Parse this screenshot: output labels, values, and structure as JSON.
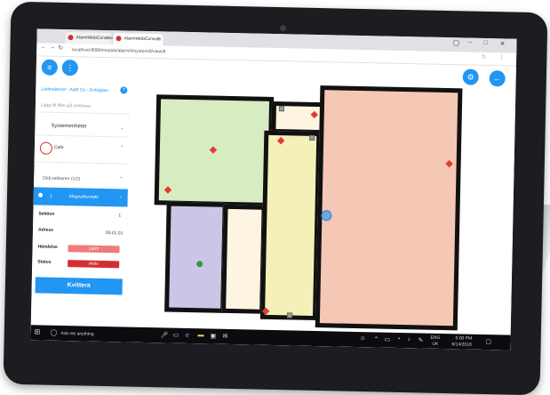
{
  "browser": {
    "tabs": [
      {
        "title": "AlarmWebConsole",
        "active": false
      },
      {
        "title": "AlarmWebConsole",
        "active": true
      }
    ],
    "address": "localhost:8080/module/alarm/#/system/8/view/8"
  },
  "sidebar": {
    "menu_icon": "menu-icon",
    "more_icon": "more-vert-icon",
    "floorplan_title": "Lantmäteriet - A&B Co - Entréplan",
    "search_placeholder": "Lägg till filter på sektioner",
    "system_units_label": "Systemenheter",
    "unit_name": "Cafe",
    "hidden_sections_label": "Dölj sektioner (1/2)",
    "section_number": "1",
    "section_name": "Magnetkontakt",
    "details": {
      "section_label": "Sektion",
      "section_value": "1",
      "address_label": "Adress",
      "address_value": "00.01.01",
      "event_label": "Händelse",
      "event_value": "Larm",
      "status_label": "Status",
      "status_value": "Aktiv"
    },
    "acknowledge_label": "Kvittera"
  },
  "map": {
    "settings_icon": "gear-icon",
    "back_icon": "arrow-left-icon",
    "colors": {
      "green_room": "#d8ecc2",
      "purple_room": "#cdc5e6",
      "cream_room": "#fdf5e2",
      "yellow_room": "#f4f0b8",
      "salmon_room": "#f4c8b5"
    }
  },
  "taskbar": {
    "search_placeholder": "Ask me anything",
    "language": "ENG",
    "region": "UK",
    "time": "5:00 PM",
    "date": "6/14/2018"
  }
}
